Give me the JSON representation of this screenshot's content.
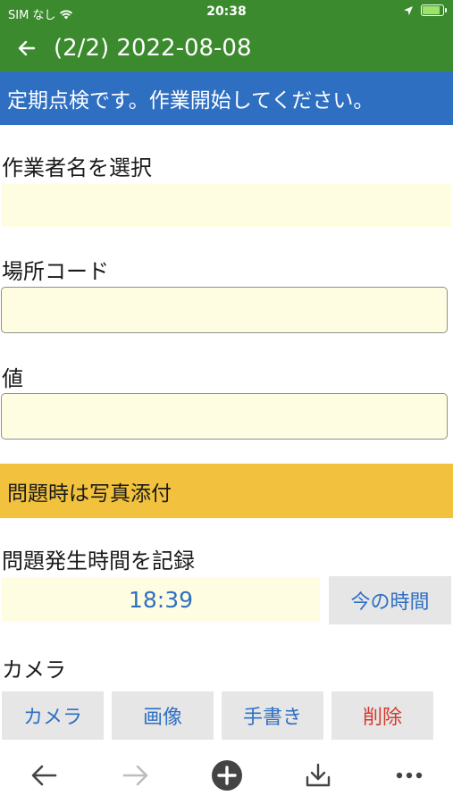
{
  "status_bar": {
    "carrier": "SIM なし",
    "time": "20:38"
  },
  "app_bar": {
    "title": "(2/2) 2022-08-08",
    "back_icon": "arrow-left-icon"
  },
  "notice": "定期点検です。作業開始してください。",
  "form": {
    "worker_label": "作業者名を選択",
    "worker_value": "",
    "location_label": "場所コード",
    "location_value": "",
    "value_label": "値",
    "value_value": "",
    "photo_notice": "問題時は写真添付",
    "issue_time_label": "問題発生時間を記録",
    "issue_time_value": "18:39",
    "now_button": "今の時間",
    "camera_label": "カメラ",
    "camera_buttons": {
      "camera": "カメラ",
      "image": "画像",
      "handwriting": "手書き",
      "delete": "削除"
    }
  },
  "toolbar": {
    "icons": [
      "arrow-back-icon",
      "arrow-forward-icon",
      "add-circle-icon",
      "download-icon",
      "more-icon"
    ]
  },
  "colors": {
    "header_green": "#3c8a2e",
    "banner_blue": "#2f6fc2",
    "banner_yellow": "#f2c23e",
    "field_yellow": "#fffde1",
    "delete_red": "#d33a2c"
  }
}
